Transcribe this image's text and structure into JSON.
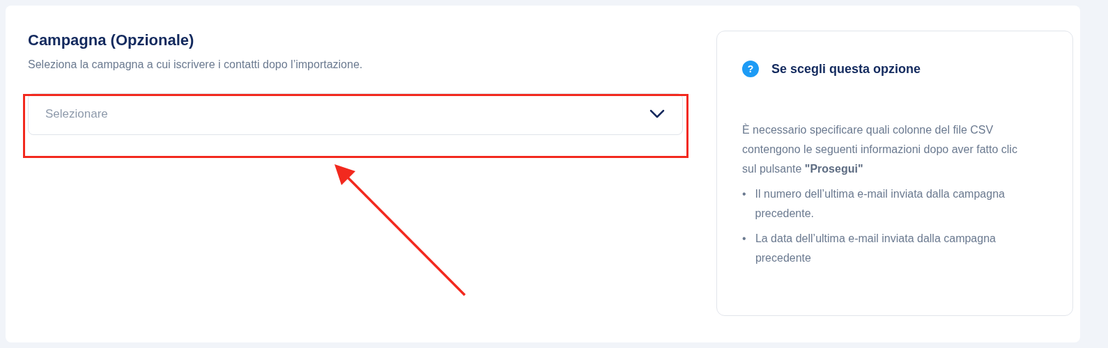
{
  "section": {
    "title": "Campagna (Opzionale)",
    "description": "Seleziona la campagna a cui iscrivere i contatti dopo l’importazione."
  },
  "campaign_select": {
    "placeholder": "Selezionare"
  },
  "annotation": {
    "highlight": true,
    "arrow": true
  },
  "info_panel": {
    "icon": "?",
    "title": "Se scegli questa opzione",
    "text": "È necessario specificare quali colonne del file CSV contengono le seguenti informazioni dopo aver fatto clic sul pulsante **\"Prosegui\"**",
    "items": [
      {
        "bullet": "•",
        "text": "Il numero dell’ultima e-mail inviata dalla campagna precedente."
      },
      {
        "bullet": "•",
        "text": "La data dell’ultima e-mail inviata dalla campagna precedente"
      }
    ]
  }
}
